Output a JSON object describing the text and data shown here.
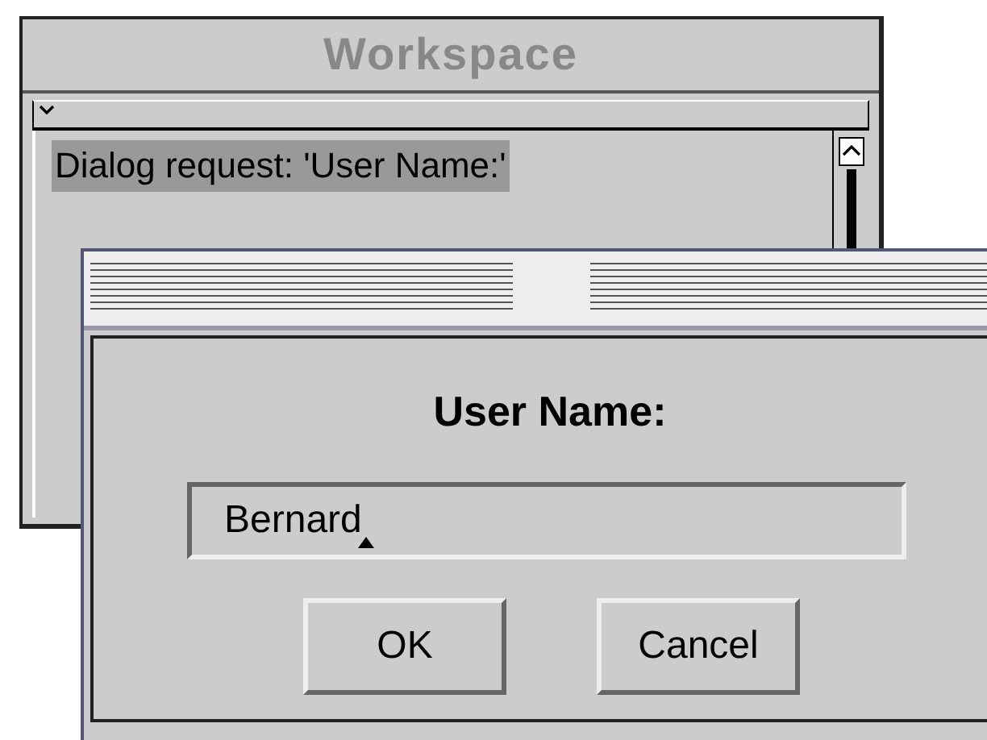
{
  "workspace": {
    "title": "Workspace",
    "lines": [
      {
        "text": "Dialog request: 'User Name:'",
        "selected": true
      }
    ]
  },
  "dialog": {
    "prompt": "User Name:",
    "field": {
      "value": "Bernard"
    },
    "buttons": [
      {
        "label": "OK"
      },
      {
        "label": "Cancel"
      }
    ]
  }
}
